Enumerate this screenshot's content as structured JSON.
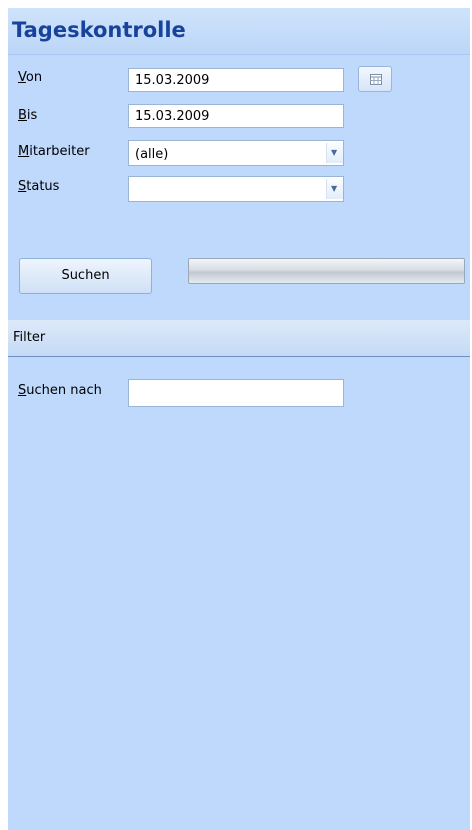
{
  "header": {
    "title": "Tageskontrolle"
  },
  "form": {
    "von": {
      "label": "Von",
      "value": "15.03.2009"
    },
    "bis": {
      "label": "Bis",
      "value": "15.03.2009"
    },
    "mitarbeiter": {
      "label": "Mitarbeiter",
      "value": "(alle)"
    },
    "status": {
      "label": "Status",
      "value": ""
    }
  },
  "actions": {
    "search_label": "Suchen"
  },
  "filter": {
    "section_title": "Filter",
    "search_label": "Suchen nach",
    "search_value": ""
  },
  "icons": {
    "calendar": "calendar-icon",
    "dropdown": "chevron-down-icon"
  }
}
